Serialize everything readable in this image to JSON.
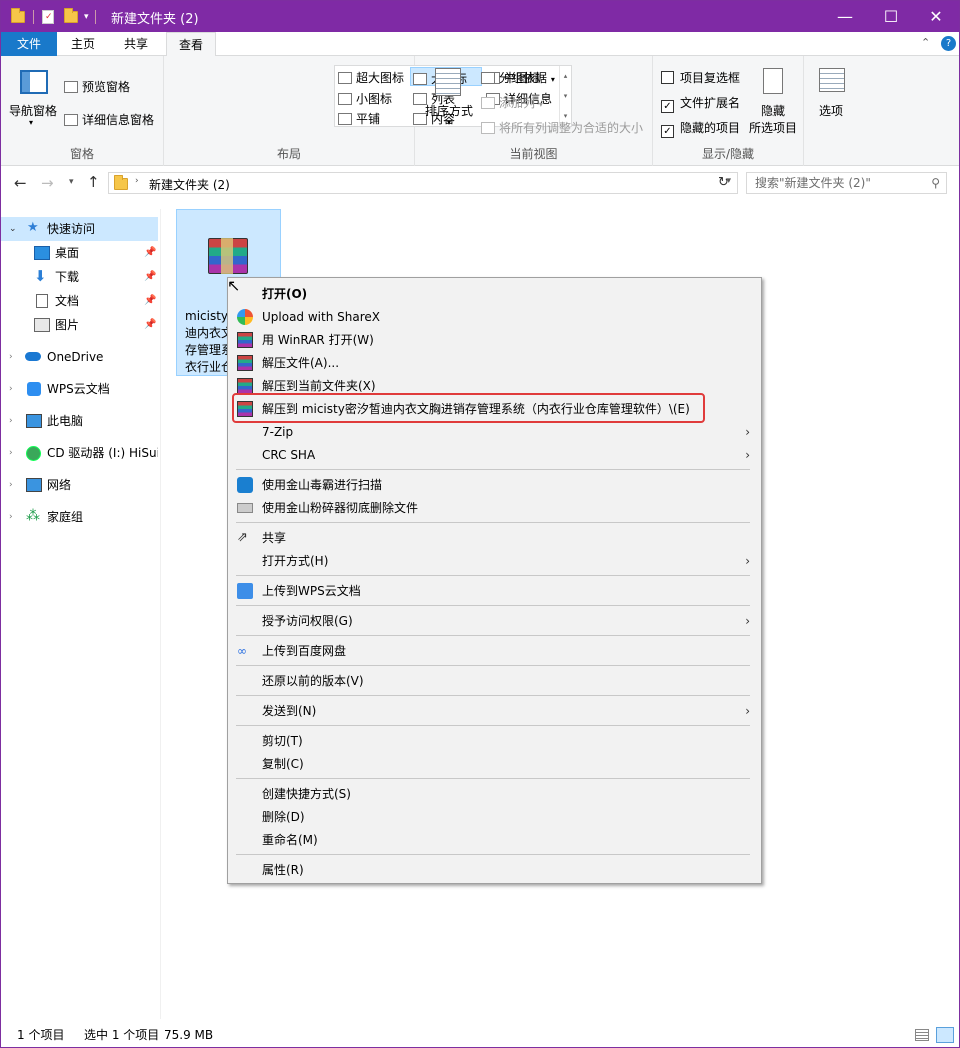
{
  "window": {
    "title": "新建文件夹 (2)",
    "minimize": "—",
    "maximize": "☐",
    "close": "✕"
  },
  "tabs": {
    "file": "文件",
    "home": "主页",
    "share": "共享",
    "view": "查看"
  },
  "ribbon": {
    "pane": {
      "nav_pane": "导航窗格",
      "preview": "预览窗格",
      "details": "详细信息窗格",
      "label": "窗格"
    },
    "layout": {
      "xl": "超大图标",
      "large": "大图标",
      "medium": "中图标",
      "small": "小图标",
      "list": "列表",
      "details": "详细信息",
      "tiles": "平铺",
      "content": "内容",
      "label": "布局"
    },
    "current_view": {
      "sort": "排序方式",
      "group": "分组依据",
      "add_col": "添加列",
      "fit_cols": "将所有列调整为合适的大小",
      "label": "当前视图"
    },
    "show_hide": {
      "checkboxes": "项目复选框",
      "extensions": "文件扩展名",
      "hidden": "隐藏的项目",
      "hide_selected_1": "隐藏",
      "hide_selected_2": "所选项目",
      "label": "显示/隐藏",
      "ext_checked": "✓",
      "hidden_checked": "✓"
    },
    "options": "选项"
  },
  "address": {
    "path": "新建文件夹 (2)",
    "search_placeholder": "搜索\"新建文件夹 (2)\""
  },
  "sidebar": {
    "quick_access": "快速访问",
    "desktop": "桌面",
    "downloads": "下载",
    "documents": "文档",
    "pictures": "图片",
    "onedrive": "OneDrive",
    "wps": "WPS云文档",
    "thispc": "此电脑",
    "cd": "CD 驱动器 (I:) HiSuit",
    "network": "网络",
    "homegroup": "家庭组"
  },
  "file": {
    "name": "micisty密汐皙迪内衣文胸进销存管理系统（内衣行业仓库管理软件）"
  },
  "status": {
    "count": "1 个项目",
    "selected": "选中 1 个项目",
    "size": "75.9 MB"
  },
  "menu": {
    "open": "打开(O)",
    "sharex": "Upload with ShareX",
    "winrar_open": "用 WinRAR 打开(W)",
    "extract": "解压文件(A)...",
    "extract_here": "解压到当前文件夹(X)",
    "extract_to": "解压到 micisty密汐皙迪内衣文胸进销存管理系统（内衣行业仓库管理软件）\\(E)",
    "zip": "7-Zip",
    "crc": "CRC SHA",
    "kingsoft_scan": "使用金山毒霸进行扫描",
    "kingsoft_shred": "使用金山粉碎器彻底删除文件",
    "share": "共享",
    "open_with": "打开方式(H)",
    "wps_upload": "上传到WPS云文档",
    "grant": "授予访问权限(G)",
    "baidu": "上传到百度网盘",
    "restore": "还原以前的版本(V)",
    "send_to": "发送到(N)",
    "cut": "剪切(T)",
    "copy": "复制(C)",
    "shortcut": "创建快捷方式(S)",
    "delete": "删除(D)",
    "rename": "重命名(M)",
    "properties": "属性(R)",
    "submenu_arrow": "›"
  }
}
